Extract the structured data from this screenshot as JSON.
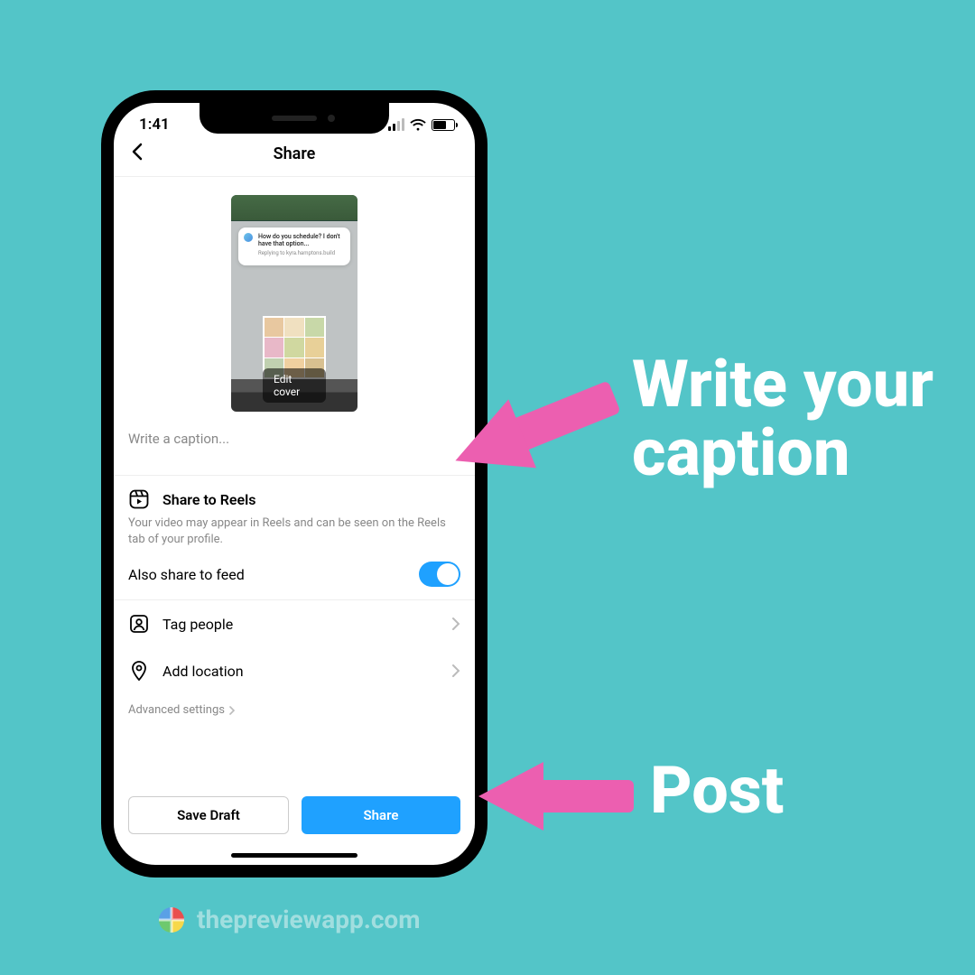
{
  "status": {
    "time": "1:41"
  },
  "nav": {
    "title": "Share"
  },
  "cover": {
    "edit_label": "Edit cover",
    "bubble_q": "How do you schedule? I don't have that option...",
    "bubble_r": "Replying to kyra.hamptons.build"
  },
  "caption": {
    "placeholder": "Write a caption..."
  },
  "reels": {
    "title": "Share to Reels",
    "desc": "Your video may appear in Reels and can be seen on the Reels tab of your profile.",
    "also_feed": "Also share to feed"
  },
  "options": {
    "tag_people": "Tag people",
    "add_location": "Add location",
    "advanced": "Advanced settings"
  },
  "buttons": {
    "draft": "Save Draft",
    "share": "Share"
  },
  "annotations": {
    "caption": "Write your caption",
    "post": "Post"
  },
  "brand": {
    "url": "thepreviewapp.com"
  }
}
